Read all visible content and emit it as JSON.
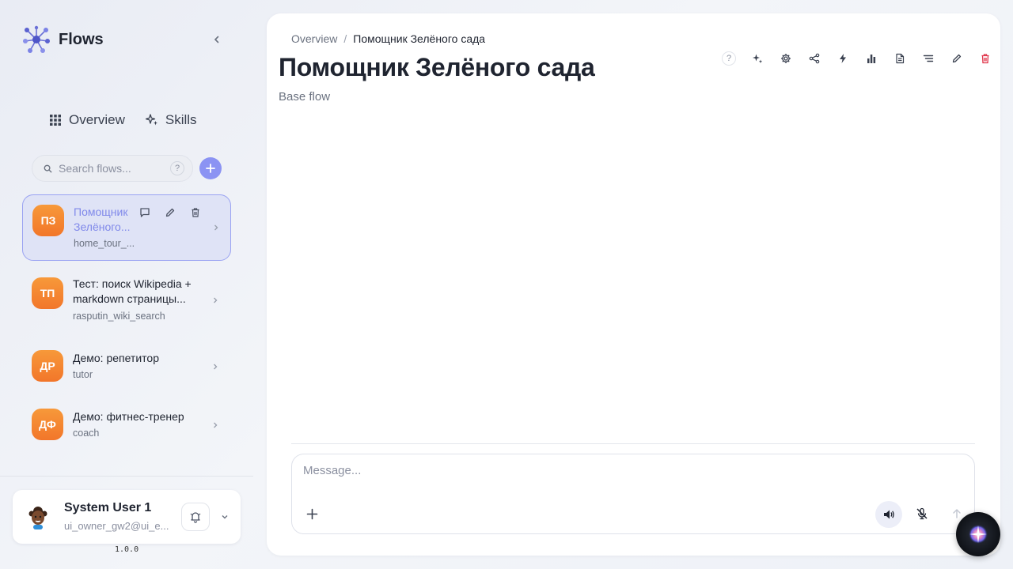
{
  "app": {
    "name": "Flows",
    "version": "1.0.0"
  },
  "nav": {
    "overview": "Overview",
    "skills": "Skills"
  },
  "search": {
    "placeholder": "Search flows...",
    "help": "?"
  },
  "flows": [
    {
      "initials": "ПЗ",
      "title_line1": "Помощник",
      "title_line2": "Зелёного...",
      "slug": "home_tour_...",
      "active": true
    },
    {
      "initials": "ТП",
      "title_line1": "Тест: поиск Wikipedia +",
      "title_line2": "markdown страницы...",
      "slug": "rasputin_wiki_search",
      "active": false
    },
    {
      "initials": "ДР",
      "title_line1": "Демо: репетитор",
      "title_line2": "",
      "slug": "tutor",
      "active": false
    },
    {
      "initials": "ДФ",
      "title_line1": "Демо: фитнес-тренер",
      "title_line2": "",
      "slug": "coach",
      "active": false
    }
  ],
  "user": {
    "name": "System User 1",
    "email": "ui_owner_gw2@ui_e..."
  },
  "breadcrumb": {
    "root": "Overview",
    "sep": "/",
    "current": "Помощник Зелёного сада"
  },
  "page": {
    "title": "Помощник Зелёного сада",
    "subtitle": "Base flow"
  },
  "toolbar_icons": [
    "help-icon",
    "sparkle-icon",
    "settings-gear-icon",
    "share-icon",
    "lightning-icon",
    "analytics-chart-icon",
    "document-icon",
    "list-icon",
    "edit-pencil-icon",
    "delete-trash-icon"
  ],
  "composer": {
    "placeholder": "Message..."
  },
  "colors": {
    "accent": "#8b93f3",
    "avatar_orange": "#f2762a",
    "danger": "#e0344a"
  }
}
